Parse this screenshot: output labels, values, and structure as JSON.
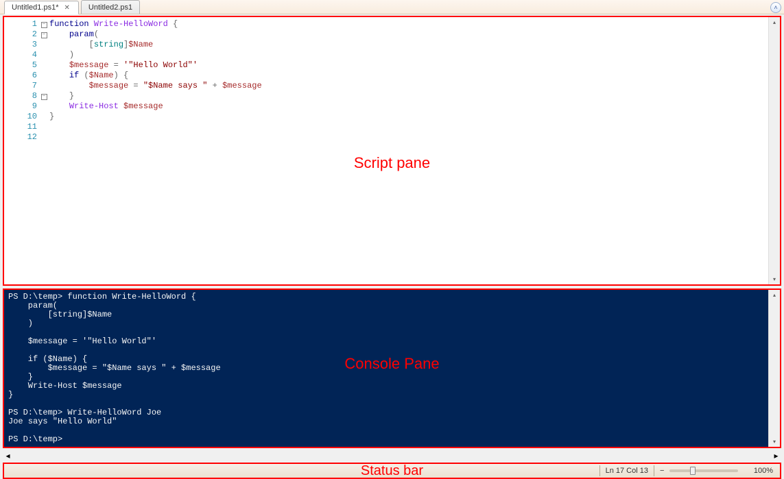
{
  "tabs": [
    {
      "label": "Untitled1.ps1*",
      "active": true,
      "closable": true
    },
    {
      "label": "Untitled2.ps1",
      "active": false,
      "closable": false
    }
  ],
  "annotations": {
    "script_pane": "Script pane",
    "console_pane": "Console Pane",
    "status_bar": "Status bar"
  },
  "code": {
    "lines": [
      {
        "n": "1",
        "fold": "minus",
        "tokens": [
          [
            "kw",
            "function"
          ],
          [
            "",
            ""
          ],
          [
            "cmd",
            " Write-HelloWord"
          ],
          [
            "",
            ""
          ],
          [
            "op",
            " {"
          ]
        ]
      },
      {
        "n": "2",
        "fold": "minus",
        "tokens": [
          [
            "",
            "    "
          ],
          [
            "kw",
            "param"
          ],
          [
            "op",
            "("
          ]
        ]
      },
      {
        "n": "3",
        "fold": "",
        "tokens": [
          [
            "",
            "        "
          ],
          [
            "op",
            "["
          ],
          [
            "type",
            "string"
          ],
          [
            "op",
            "]"
          ],
          [
            "var",
            "$Name"
          ]
        ]
      },
      {
        "n": "4",
        "fold": "",
        "tokens": [
          [
            "",
            "    "
          ],
          [
            "op",
            ")"
          ]
        ]
      },
      {
        "n": "5",
        "fold": "",
        "tokens": [
          [
            "",
            ""
          ]
        ]
      },
      {
        "n": "6",
        "fold": "",
        "tokens": [
          [
            "",
            "    "
          ],
          [
            "var",
            "$message"
          ],
          [
            "op",
            " = "
          ],
          [
            "str",
            "'\"Hello World\"'"
          ]
        ]
      },
      {
        "n": "7",
        "fold": "",
        "tokens": [
          [
            "",
            ""
          ]
        ]
      },
      {
        "n": "8",
        "fold": "minus",
        "tokens": [
          [
            "",
            "    "
          ],
          [
            "kw",
            "if"
          ],
          [
            "op",
            " ("
          ],
          [
            "var",
            "$Name"
          ],
          [
            "op",
            ") {"
          ]
        ]
      },
      {
        "n": "9",
        "fold": "",
        "tokens": [
          [
            "",
            "        "
          ],
          [
            "var",
            "$message"
          ],
          [
            "op",
            " = "
          ],
          [
            "str",
            "\"$Name says \""
          ],
          [
            "op",
            " + "
          ],
          [
            "var",
            "$message"
          ]
        ]
      },
      {
        "n": "10",
        "fold": "",
        "tokens": [
          [
            "",
            "    "
          ],
          [
            "op",
            "}"
          ]
        ]
      },
      {
        "n": "11",
        "fold": "",
        "tokens": [
          [
            "",
            "    "
          ],
          [
            "cmd",
            "Write-Host"
          ],
          [
            "",
            " "
          ],
          [
            "var",
            "$message"
          ]
        ]
      },
      {
        "n": "12",
        "fold": "",
        "tokens": [
          [
            "op",
            "}"
          ]
        ]
      }
    ]
  },
  "console": {
    "text": "PS D:\\temp> function Write-HelloWord {\n    param(\n        [string]$Name\n    )\n\n    $message = '\"Hello World\"'\n\n    if ($Name) {\n        $message = \"$Name says \" + $message\n    }\n    Write-Host $message\n}\n\nPS D:\\temp> Write-HelloWord Joe\nJoe says \"Hello World\"\n\nPS D:\\temp>"
  },
  "status": {
    "position": "Ln 17  Col 13",
    "zoom": "100%"
  }
}
